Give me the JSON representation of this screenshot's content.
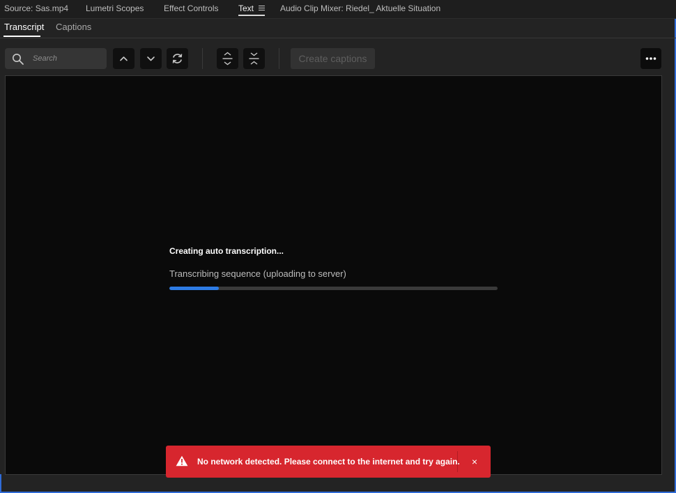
{
  "panel_tabs": [
    {
      "label": "Source: Sas.mp4",
      "active": false
    },
    {
      "label": "Lumetri Scopes",
      "active": false
    },
    {
      "label": "Effect Controls",
      "active": false
    },
    {
      "label": "Text",
      "active": true
    },
    {
      "label": "Audio Clip Mixer: Riedel_ Aktuelle Situation",
      "active": false
    }
  ],
  "subtabs": [
    {
      "label": "Transcript",
      "active": true
    },
    {
      "label": "Captions",
      "active": false
    }
  ],
  "toolbar": {
    "search_placeholder": "Search",
    "create_captions_label": "Create captions"
  },
  "main": {
    "status_title": "Creating auto transcription...",
    "status_subtitle": "Transcribing sequence (uploading to server)",
    "progress": 0.15
  },
  "toast": {
    "message": "No network detected. Please connect to the internet and try again.",
    "close_label": "×"
  },
  "colors": {
    "accent_blue": "#2d7be4",
    "error_red": "#d7262e",
    "panel_bg": "#232323",
    "content_bg": "#0a0a0a"
  },
  "icons": [
    "search-icon",
    "chevron-up-icon",
    "chevron-down-icon",
    "refresh-icon",
    "expand-icon",
    "collapse-icon",
    "more-icon",
    "warning-icon",
    "close-icon",
    "menu-icon"
  ]
}
